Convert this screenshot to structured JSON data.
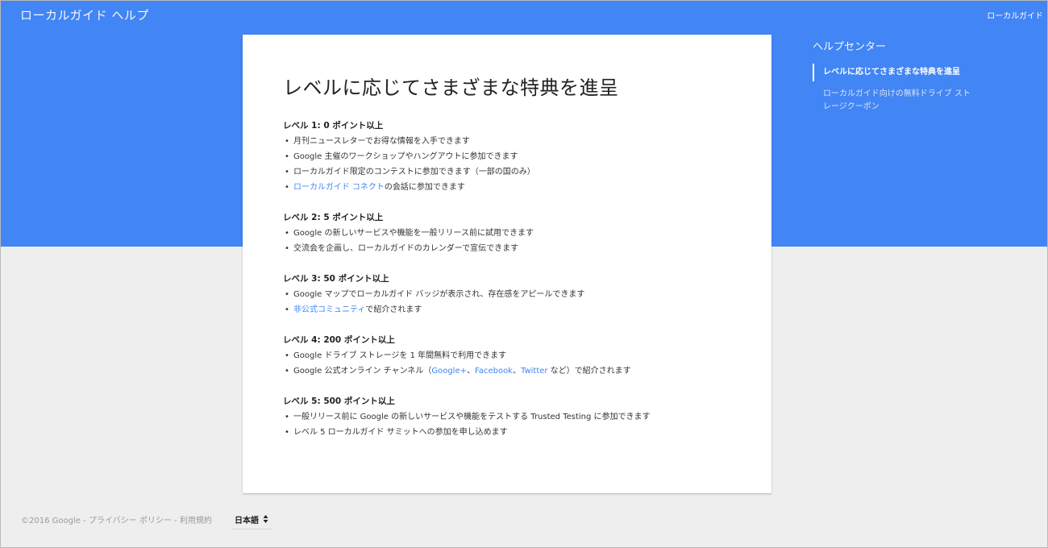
{
  "header": {
    "app_title": "ローカルガイド ヘルプ",
    "right_link": "ローカルガイド"
  },
  "article": {
    "title": "レベルに応じてさまざまな特典を進呈",
    "levels": [
      {
        "heading": "レベル 1: 0 ポイント以上",
        "items": [
          "月刊ニュースレターでお得な情報を入手できます",
          "Google 主催のワークショップやハングアウトに参加できます",
          "ローカルガイド限定のコンテストに参加できます（一部の国のみ）"
        ],
        "link_item": {
          "link": "ローカルガイド コネクト",
          "after": "の会話に参加できます"
        }
      },
      {
        "heading": "レベル 2: 5 ポイント以上",
        "items": [
          "Google の新しいサービスや機能を一般リリース前に試用できます",
          "交流会を企画し、ローカルガイドのカレンダーで宣伝できます"
        ]
      },
      {
        "heading": "レベル 3: 50 ポイント以上",
        "items": [
          "Google マップでローカルガイド バッジが表示され、存在感をアピールできます"
        ],
        "link_item": {
          "link": "非公式コミュニティ",
          "after": "で紹介されます"
        }
      },
      {
        "heading": "レベル 4: 200 ポイント以上",
        "items": [
          "Google ドライブ ストレージを 1 年間無料で利用できます"
        ],
        "channels_item": {
          "before": "Google 公式オンライン チャンネル（",
          "link1": "Google+",
          "sep1": "、",
          "link2": "Facebook",
          "sep2": "、",
          "link3": "Twitter",
          "after": " など）で紹介されます"
        }
      },
      {
        "heading": "レベル 5: 500 ポイント以上",
        "items": [
          "一般リリース前に Google の新しいサービスや機能をテストする Trusted Testing に参加できます",
          "レベル 5 ローカルガイド サミットへの参加を申し込めます"
        ]
      }
    ]
  },
  "sidebar": {
    "title": "ヘルプセンター",
    "items": [
      {
        "label": "レベルに応じてさまざまな特典を進呈",
        "active": true
      },
      {
        "label": "ローカルガイド向けの無料ドライブ ストレージクーポン",
        "active": false
      }
    ]
  },
  "footer": {
    "copyright": "©2016 Google",
    "sep": " - ",
    "privacy": "プライバシー ポリシー",
    "terms": "利用規約"
  },
  "language": {
    "selected": "日本語"
  },
  "colors": {
    "brand_blue": "#4285f4",
    "background": "#eeeeee",
    "link": "#4285f4"
  },
  "bullet": "•"
}
